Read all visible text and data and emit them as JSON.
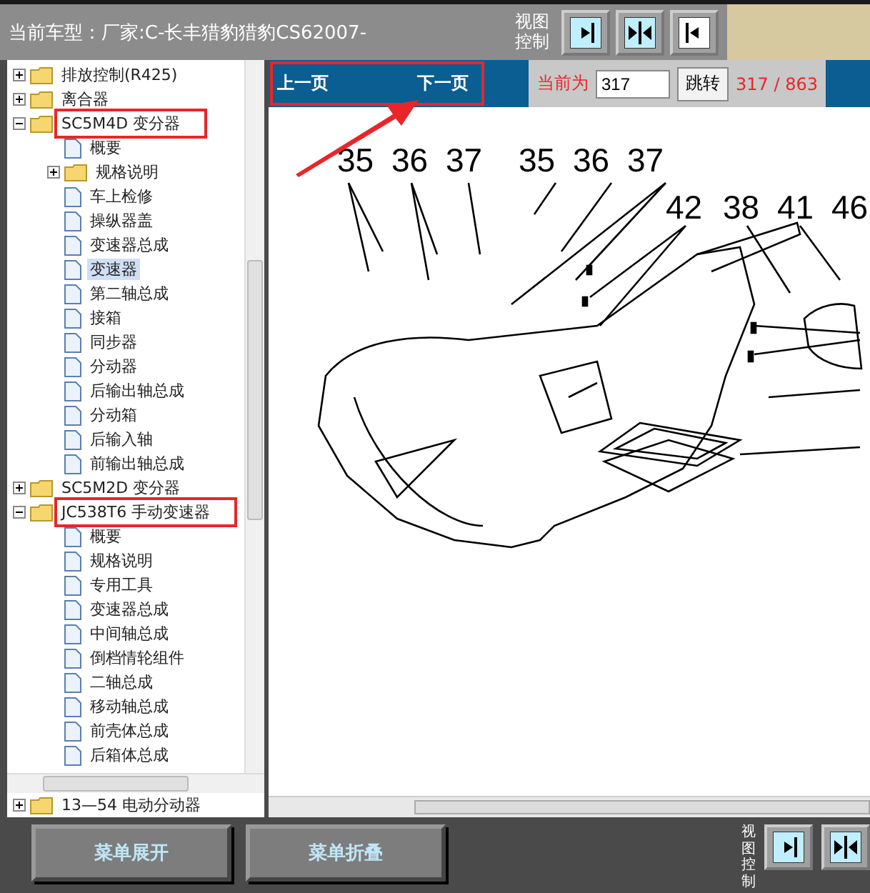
{
  "header": {
    "title": "当前车型：厂家:C-长丰猎豹猎豹CS62007-",
    "view_label": "视图控制"
  },
  "tree": [
    {
      "label": "排放控制(R425)",
      "kind": "folder",
      "expanded": false,
      "selected": false,
      "annotated": false
    },
    {
      "label": "离合器",
      "kind": "folder",
      "expanded": false,
      "selected": false,
      "annotated": false
    },
    {
      "label": "SC5M4D 变分器",
      "kind": "folder",
      "expanded": true,
      "selected": false,
      "annotated": true,
      "children": [
        {
          "label": "概要",
          "kind": "page",
          "selected": false
        },
        {
          "label": "规格说明",
          "kind": "folder",
          "expanded": false,
          "selected": false,
          "annotated": false
        },
        {
          "label": "车上检修",
          "kind": "page",
          "selected": false
        },
        {
          "label": "操纵器盖",
          "kind": "page",
          "selected": false
        },
        {
          "label": "变速器总成",
          "kind": "page",
          "selected": false
        },
        {
          "label": "变速器",
          "kind": "page",
          "selected": true
        },
        {
          "label": "第二轴总成",
          "kind": "page",
          "selected": false
        },
        {
          "label": "接箱",
          "kind": "page",
          "selected": false
        },
        {
          "label": "同步器",
          "kind": "page",
          "selected": false
        },
        {
          "label": "分动器",
          "kind": "page",
          "selected": false
        },
        {
          "label": "后输出轴总成",
          "kind": "page",
          "selected": false
        },
        {
          "label": "分动箱",
          "kind": "page",
          "selected": false
        },
        {
          "label": "后输入轴",
          "kind": "page",
          "selected": false
        },
        {
          "label": "前输出轴总成",
          "kind": "page",
          "selected": false
        }
      ]
    },
    {
      "label": "SC5M2D 变分器",
      "kind": "folder",
      "expanded": false,
      "selected": false,
      "annotated": false
    },
    {
      "label": "JC538T6 手动变速器",
      "kind": "folder",
      "expanded": true,
      "selected": false,
      "annotated": true,
      "children": [
        {
          "label": "概要",
          "kind": "page",
          "selected": false
        },
        {
          "label": "规格说明",
          "kind": "page",
          "selected": false
        },
        {
          "label": "专用工具",
          "kind": "page",
          "selected": false
        },
        {
          "label": "变速器总成",
          "kind": "page",
          "selected": false
        },
        {
          "label": "中间轴总成",
          "kind": "page",
          "selected": false
        },
        {
          "label": "倒档情轮组件",
          "kind": "page",
          "selected": false
        },
        {
          "label": "二轴总成",
          "kind": "page",
          "selected": false
        },
        {
          "label": "移动轴总成",
          "kind": "page",
          "selected": false
        },
        {
          "label": "前壳体总成",
          "kind": "page",
          "selected": false
        },
        {
          "label": "后箱体总成",
          "kind": "page",
          "selected": false
        }
      ]
    }
  ],
  "tree_tail": {
    "label": "13—54 电动分动器",
    "kind": "folder",
    "expanded": false,
    "selected": false,
    "annotated": false
  },
  "pager": {
    "prev": "上一页",
    "next": "下一页",
    "annotated": true,
    "current_label": "当前为",
    "page_value": "317",
    "jump": "跳转",
    "count": "317 / 863"
  },
  "diagram": {
    "callouts": [
      "35",
      "36",
      "37",
      "35",
      "36",
      "37",
      "42",
      "38",
      "41",
      "46"
    ]
  },
  "footer": {
    "buttons": [
      "菜单展开",
      "菜单折叠"
    ],
    "view_label": "视图控制"
  }
}
